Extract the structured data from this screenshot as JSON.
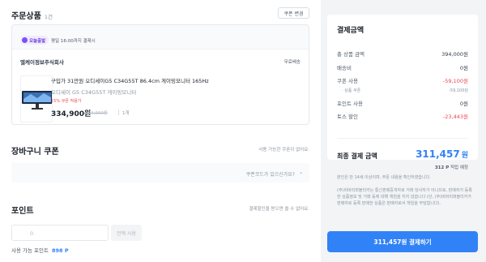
{
  "order": {
    "title": "주문상품",
    "count": "1건",
    "coupon_change_label": "쿠폰 변경",
    "delivery_badge": "오늘출발",
    "delivery_note": "평일 16:00까지 결제시",
    "seller": "엘케이정보주식회사",
    "shipping": "무료배송",
    "product_name": "구입가 31만원 오디세이G5 C34G55T 86.4cm 게이밍모니터 165Hz",
    "option_name": "오디세이 G5 C34G55T 게이밍모니터",
    "discount_line": "15% 쿠폰 적용가",
    "price": "334,900원",
    "original_price": "394,000원",
    "quantity": "1개"
  },
  "cart_coupon": {
    "title": "장바구니 쿠폰",
    "note": "사용 가능한 쿠폰이 없어요.",
    "field_placeholder": "쿠폰코드가 있으신가요?"
  },
  "points": {
    "title": "포인트",
    "note": "결제할인을 받으면 쓸 수 없어요.",
    "input_value": "0",
    "use_all_label": "전액 사용",
    "available_label": "사용 가능 포인트",
    "available_value": "898 P"
  },
  "payment": {
    "title": "결제금액",
    "rows": [
      {
        "label": "총 상품 금액",
        "value": "394,000원"
      },
      {
        "label": "배송비",
        "value": "0원"
      },
      {
        "label": "쿠폰 사용",
        "value": "-59,100원"
      },
      {
        "label": "· 상품 쿠폰",
        "value": "-59,100원"
      },
      {
        "label": "포인트 사용",
        "value": "0원"
      },
      {
        "label": "토스 할인",
        "value": "-23,443원"
      }
    ],
    "final_label": "최종 결제 금액",
    "final_value": "311,457",
    "final_unit": "원",
    "earn_points": "312 P",
    "earn_suffix": "적립 예정",
    "notice_1": "본인은 만 14세 이상이며, 주문 내용을 확인하였습니다.",
    "notice_2": "(주)비바리퍼블리카는 통신판매중개자로 거래 당사자가 아니므로, 판매자가 등록한 상품정보 및 거래 등에 대해 책임을 지지 않습니다 (단, (주)비바리퍼블리카가 판매자로 등록 판매한 상품은 판매자로서 책임을 부담합니다).",
    "pay_button": "311,457원 결제하기"
  },
  "colors": {
    "accent": "#3182f6",
    "discount_red": "#f04452",
    "badge_purple": "#7c4dff"
  }
}
